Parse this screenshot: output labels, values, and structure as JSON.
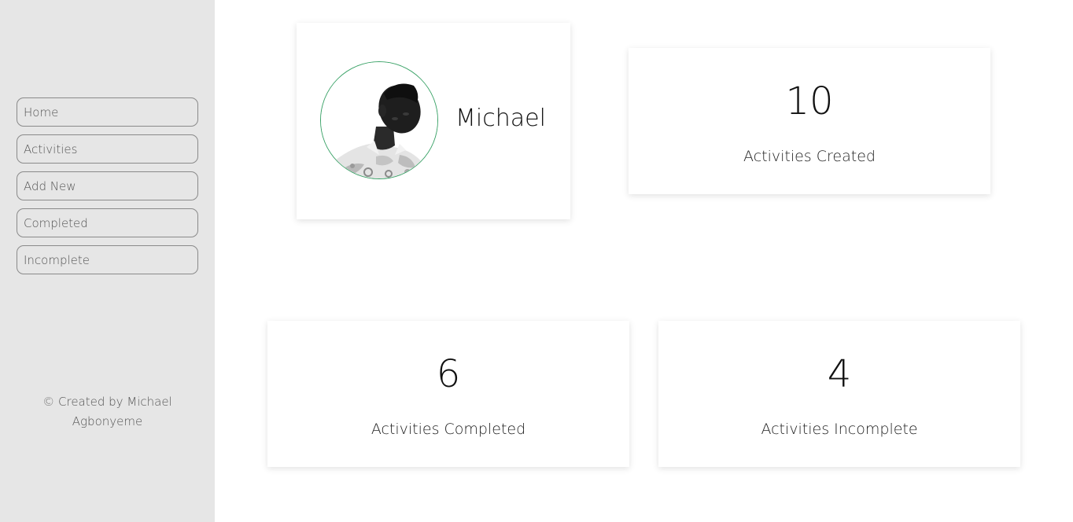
{
  "sidebar": {
    "items": [
      {
        "label": "Home"
      },
      {
        "label": "Activities"
      },
      {
        "label": "Add New"
      },
      {
        "label": "Completed"
      },
      {
        "label": "Incomplete"
      }
    ],
    "footer_line1": "© Created by Michael",
    "footer_line2": "Agbonyeme"
  },
  "profile": {
    "name": "Michael",
    "avatar_border_color": "#3aa267"
  },
  "stats": {
    "created": {
      "value": "10",
      "label": "Activities Created"
    },
    "completed": {
      "value": "6",
      "label": "Activities Completed"
    },
    "incomplete": {
      "value": "4",
      "label": "Activities Incomplete"
    }
  }
}
